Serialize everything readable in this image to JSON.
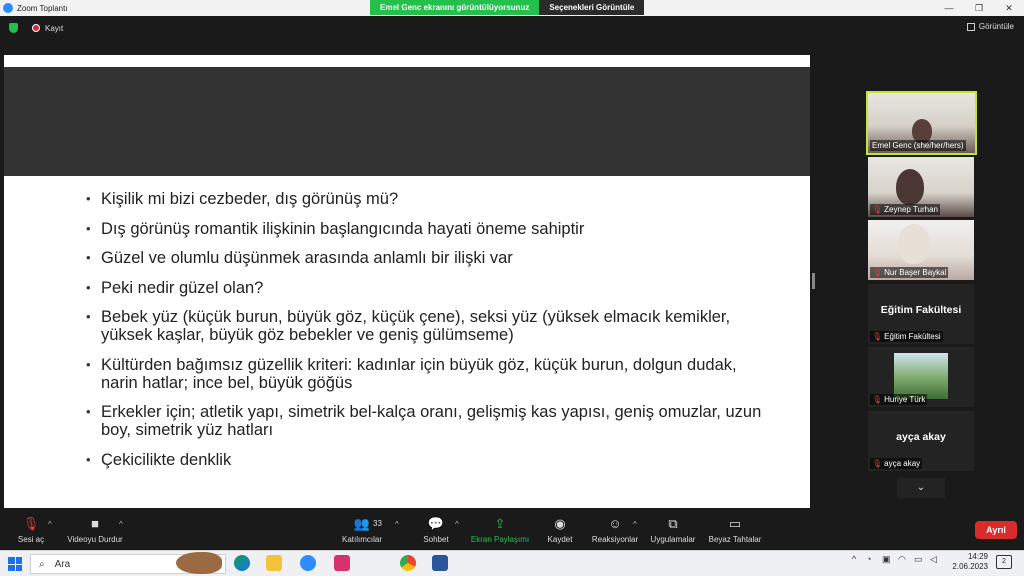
{
  "window": {
    "title": "Zoom Toplantı",
    "share_message": "Emel Genc ekranını görüntülüyorsunuz",
    "view_options": "Seçenekleri Görüntüle",
    "controls": [
      "—",
      "❐",
      "✕"
    ]
  },
  "topbar": {
    "record_label": "Kayıt",
    "view_label": "Görüntüle"
  },
  "slide": {
    "bullets": [
      "Kişilik mi bizi cezbeder, dış görünüş mü?",
      "Dış görünüş romantik ilişkinin başlangıcında hayati öneme sahiptir",
      "Güzel ve olumlu düşünmek arasında anlamlı bir ilişki var",
      "Peki nedir güzel olan?",
      "Bebek yüz (küçük burun, büyük göz, küçük çene), seksi yüz (yüksek elmacık kemikler, yüksek kaşlar, büyük göz bebekler ve geniş gülümseme)",
      "Kültürden bağımsız güzellik kriteri: kadınlar için büyük göz, küçük burun, dolgun dudak, narin hatlar; ince bel, büyük göğüs",
      "Erkekler için; atletik yapı, simetrik bel-kalça oranı, gelişmiş kas yapısı, geniş omuzlar, uzun boy, simetrik yüz hatları",
      "Çekicilikte denklik"
    ]
  },
  "participants": [
    {
      "name": "Emel Genc (she/her/hers)",
      "type": "video",
      "active": true,
      "muted": false
    },
    {
      "name": "Zeynep Turhan",
      "type": "video",
      "active": false,
      "muted": true
    },
    {
      "name": "Nur Başer Baykal",
      "type": "video",
      "active": false,
      "muted": true
    },
    {
      "name": "Eğitim Fakültesi",
      "type": "name",
      "display": "Eğitim Fakültesi",
      "active": false,
      "muted": true
    },
    {
      "name": "Huriye Türk",
      "type": "video",
      "active": false,
      "muted": true
    },
    {
      "name": "ayça akay",
      "type": "name",
      "display": "ayça akay",
      "active": false,
      "muted": true
    }
  ],
  "toolbar": {
    "unmute": "Sesi aç",
    "stop_video": "Videoyu Durdur",
    "participants": "Katılımcılar",
    "participants_count": "33",
    "chat": "Sohbet",
    "share_screen": "Ekran Paylaşımı",
    "record": "Kaydet",
    "reactions": "Reaksiyonlar",
    "apps": "Uygulamalar",
    "whiteboards": "Beyaz Tahtalar",
    "leave": "Ayrıl"
  },
  "taskbar": {
    "search_placeholder": "Ara",
    "time": "14:29",
    "date": "2.06.2023",
    "notifications": "2",
    "accent_colors": {
      "zoom": "#2d8cff",
      "green": "#23c04c",
      "leave": "#d92b2b"
    }
  }
}
